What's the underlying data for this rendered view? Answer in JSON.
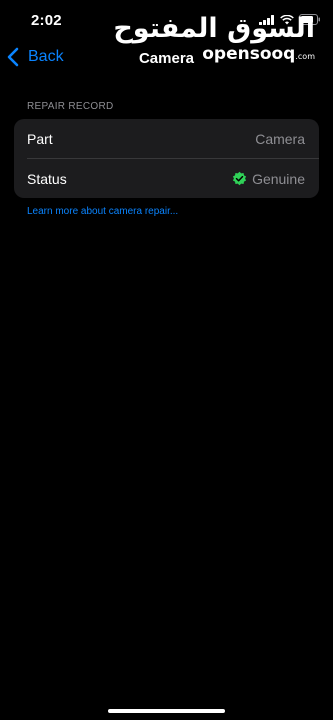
{
  "status_bar": {
    "time": "2:02"
  },
  "watermark": {
    "arabic": "السوق المفتوح",
    "latin": "opensooq",
    "suffix": ".com"
  },
  "nav": {
    "back_label": "Back",
    "title": "Camera"
  },
  "section": {
    "header": "REPAIR RECORD"
  },
  "rows": [
    {
      "label": "Part",
      "value": "Camera"
    },
    {
      "label": "Status",
      "value": "Genuine"
    }
  ],
  "footer_link": "Learn more about camera repair...",
  "colors": {
    "accent": "#0a84ff",
    "verified": "#30d158",
    "cell_bg": "#1c1c1e"
  },
  "icons": {
    "back": "chevron-left-icon",
    "status": "check-seal-icon"
  }
}
